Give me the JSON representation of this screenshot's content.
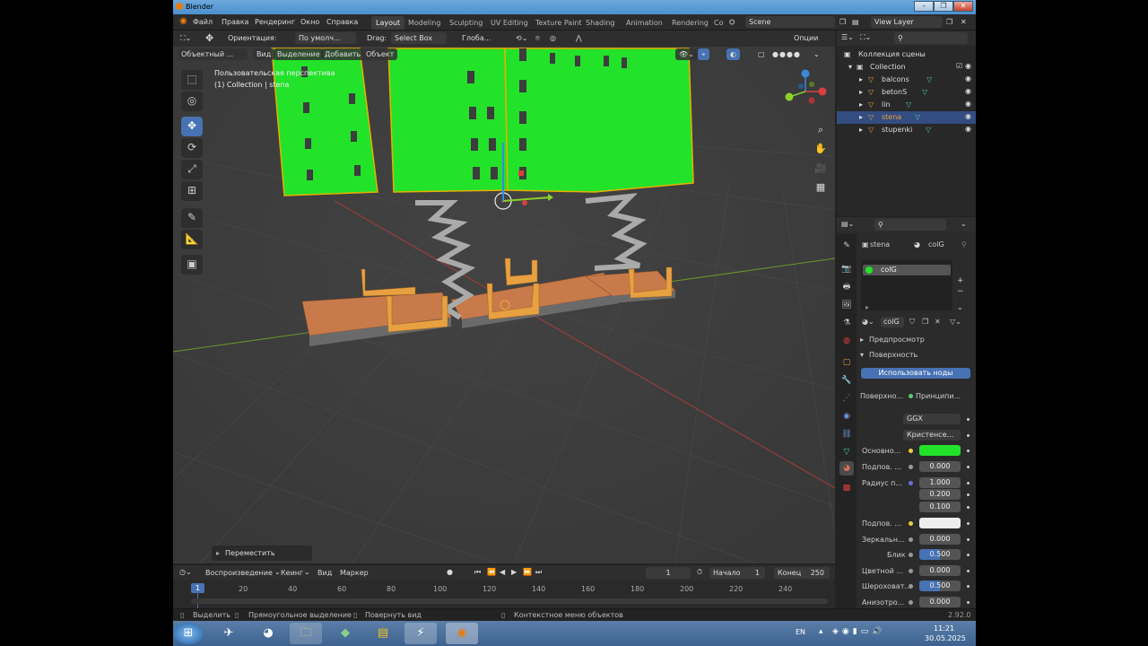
{
  "window": {
    "title": "Blender",
    "controls": [
      "–",
      "❐",
      "✕"
    ]
  },
  "menu": [
    "Файл",
    "Правка",
    "Рендеринг",
    "Окно",
    "Справка"
  ],
  "workspaces": [
    "Layout",
    "Modeling",
    "Sculpting",
    "UV Editing",
    "Texture Paint",
    "Shading",
    "Animation",
    "Rendering",
    "Co"
  ],
  "scene": "Scene",
  "view_layer": "View Layer",
  "toolbar": {
    "orientation_label": "Ориентация:",
    "orientation_value": "По умолч...",
    "drag_label": "Drag:",
    "drag_value": "Select Box",
    "transform_value": "Глоба...",
    "options": "Опции"
  },
  "viewport_header": {
    "mode": "Объектный ...",
    "view": "Вид",
    "select": "Выделение",
    "add": "Добавить",
    "object": "Объект"
  },
  "viewport_info": {
    "line1": "Пользовательская перспектива",
    "line2": "(1) Collection | stena"
  },
  "last_operator": "Переместить",
  "outliner": {
    "root": "Коллекция сцены",
    "collection": "Collection",
    "items": [
      "balcons",
      "betonS",
      "lin",
      "stena",
      "stupenki"
    ],
    "selected": "stena"
  },
  "properties": {
    "object_name": "stena",
    "material_name": "colG",
    "slot_name": "colG",
    "data_name": "colG",
    "panel_preview": "Предпросмотр",
    "panel_surface": "Поверхность",
    "use_nodes": "Использовать ноды",
    "surface_label": "Поверхно...",
    "surface_value": "Принципи...",
    "distribution": "GGX",
    "subsurface_method": "Кристенсе...",
    "rows": [
      {
        "label": "Основно...",
        "value": "",
        "color": "#22e22a"
      },
      {
        "label": "Подпов. ...",
        "value": "0.000"
      },
      {
        "label": "Радиус п...",
        "value": "1.000"
      },
      {
        "label": "",
        "value": "0.200"
      },
      {
        "label": "",
        "value": "0.100"
      },
      {
        "label": "Подпов. ...",
        "value": "",
        "color": "#eeeeee"
      },
      {
        "label": "Зеркальн...",
        "value": "0.000"
      },
      {
        "label": "Блик",
        "value": "0.500"
      },
      {
        "label": "Цветной ...",
        "value": "0.000"
      },
      {
        "label": "Шероховат...",
        "value": "0.500"
      },
      {
        "label": "Анизотро...",
        "value": "0.000"
      }
    ]
  },
  "timeline": {
    "playback": "Воспроизведение",
    "keying": "Кеинг",
    "view": "Вид",
    "marker": "Маркер",
    "current_frame": "1",
    "start_label": "Начало",
    "start": "1",
    "end_label": "Конец",
    "end": "250",
    "ruler": [
      "1",
      "20",
      "40",
      "60",
      "80",
      "100",
      "120",
      "140",
      "160",
      "180",
      "200",
      "220",
      "240"
    ]
  },
  "status": {
    "select": "Выделить",
    "box": "Прямоугольное выделение",
    "rotate": "Повернуть вид",
    "context": "Контекстное меню объектов",
    "version": "2.92.0"
  },
  "taskbar": {
    "lang": "EN",
    "time": "11:21",
    "date": "30.05.2025"
  },
  "colors": {
    "accent": "#4772b3",
    "green": "#22e22a",
    "orange": "#e8a040",
    "floor": "#c87a4a"
  }
}
